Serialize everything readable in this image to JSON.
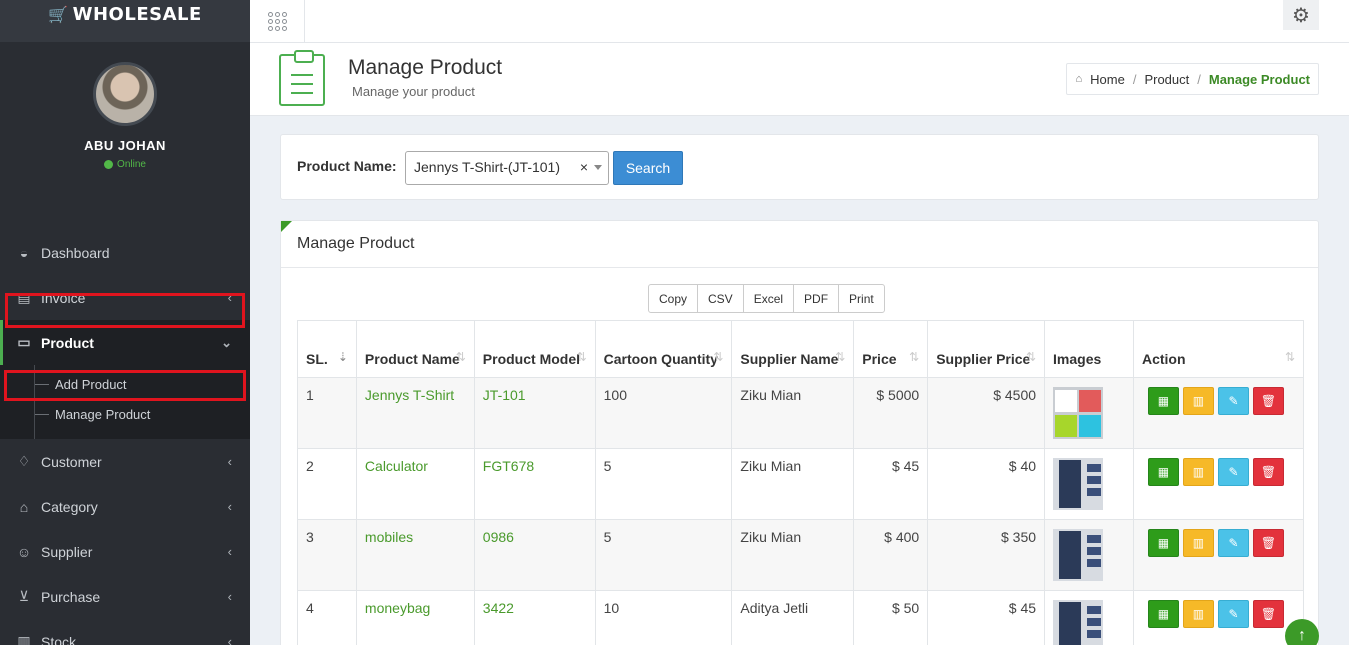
{
  "app": {
    "logo_text": "WHOLESALE"
  },
  "user": {
    "name": "ABU JOHAN",
    "status": "Online"
  },
  "sidebar": {
    "items": [
      {
        "label": "Dashboard",
        "icon": "dashboard-icon"
      },
      {
        "label": "Invoice",
        "icon": "invoice-icon"
      },
      {
        "label": "Product",
        "icon": "product-icon",
        "active": true
      },
      {
        "label": "Customer",
        "icon": "handshake-icon"
      },
      {
        "label": "Category",
        "icon": "category-icon"
      },
      {
        "label": "Supplier",
        "icon": "user-icon"
      },
      {
        "label": "Purchase",
        "icon": "cart-icon"
      },
      {
        "label": "Stock",
        "icon": "bar-chart-icon"
      }
    ],
    "product_submenu": [
      "Add Product",
      "Manage Product"
    ]
  },
  "header": {
    "title": "Manage Product",
    "subtitle": "Manage your product",
    "breadcrumb": [
      "Home",
      "Product",
      "Manage Product"
    ]
  },
  "search": {
    "label": "Product Name:",
    "selected_value": "Jennys T-Shirt-(JT-101)",
    "clear_symbol": "×",
    "button_label": "Search"
  },
  "panel": {
    "title": "Manage Product"
  },
  "export_buttons": [
    "Copy",
    "CSV",
    "Excel",
    "PDF",
    "Print"
  ],
  "table": {
    "columns": [
      "SL.",
      "Product Name",
      "Product Model",
      "Cartoon Quantity",
      "Supplier Name",
      "Price",
      "Supplier Price",
      "Images",
      "Action"
    ],
    "rows": [
      {
        "sl": "1",
        "name": "Jennys T-Shirt",
        "model": "JT-101",
        "qty": "100",
        "supplier": "Ziku Mian",
        "price": "$ 5000",
        "supplier_price": "$ 4500",
        "image": "shirts"
      },
      {
        "sl": "2",
        "name": "Calculator",
        "model": "FGT678",
        "qty": "5",
        "supplier": "Ziku Mian",
        "price": "$ 45",
        "supplier_price": "$ 40",
        "image": "jeans"
      },
      {
        "sl": "3",
        "name": "mobiles",
        "model": "0986",
        "qty": "5",
        "supplier": "Ziku Mian",
        "price": "$ 400",
        "supplier_price": "$ 350",
        "image": "jeans"
      },
      {
        "sl": "4",
        "name": "moneybag",
        "model": "3422",
        "qty": "10",
        "supplier": "Aditya Jetli",
        "price": "$ 50",
        "supplier_price": "$ 45",
        "image": "jeans"
      }
    ]
  },
  "colors": {
    "accent": "#4caf50",
    "link": "#4a9a2c",
    "highlight": "#e0141e",
    "search_button": "#3c8dd4"
  }
}
